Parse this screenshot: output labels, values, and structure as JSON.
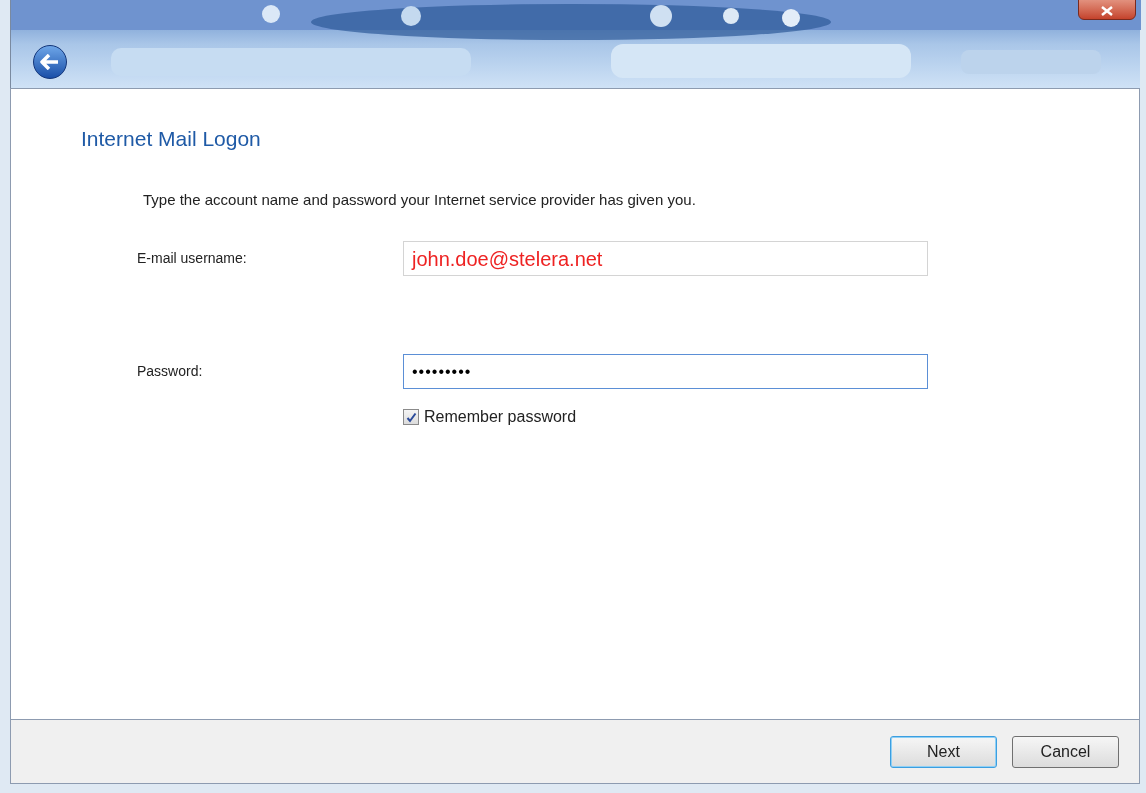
{
  "dialog": {
    "heading": "Internet Mail Logon",
    "instruction": "Type the account name and password your Internet service provider has given you.",
    "fields": [
      {
        "kind": "text",
        "label": "E-mail username:",
        "value": "john.doe@stelera.net",
        "focused": false
      },
      {
        "kind": "password",
        "label": "Password:",
        "value": "•••••••••",
        "focused": true
      }
    ],
    "remember": {
      "label": "Remember password",
      "checked": true
    },
    "buttons": [
      {
        "label": "Next",
        "default": true
      },
      {
        "label": "Cancel",
        "default": false
      }
    ]
  }
}
